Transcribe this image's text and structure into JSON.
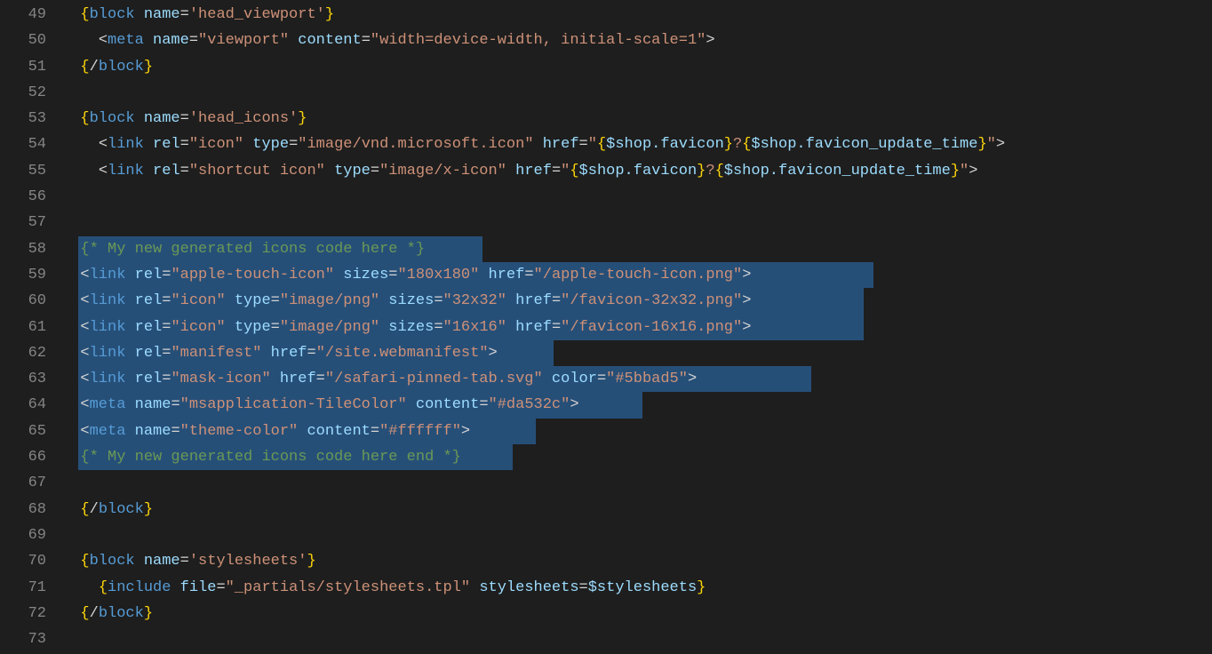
{
  "line_numbers": [
    "49",
    "50",
    "51",
    "52",
    "53",
    "54",
    "55",
    "56",
    "57",
    "58",
    "59",
    "60",
    "61",
    "62",
    "63",
    "64",
    "65",
    "66",
    "67",
    "68",
    "69",
    "70",
    "71",
    "72",
    "73"
  ],
  "lines": {
    "l49": {
      "indent": "  ",
      "t": [
        {
          "c": "t-brace",
          "s": "{"
        },
        {
          "c": "t-kw",
          "s": "block"
        },
        {
          "c": "t-delim",
          "s": " "
        },
        {
          "c": "t-attr",
          "s": "name"
        },
        {
          "c": "t-delim",
          "s": "="
        },
        {
          "c": "t-str",
          "s": "'head_viewport'"
        },
        {
          "c": "t-brace",
          "s": "}"
        }
      ]
    },
    "l50": {
      "indent": "    ",
      "t": [
        {
          "c": "t-delim",
          "s": "<"
        },
        {
          "c": "t-tag",
          "s": "meta"
        },
        {
          "c": "t-delim",
          "s": " "
        },
        {
          "c": "t-attr",
          "s": "name"
        },
        {
          "c": "t-delim",
          "s": "="
        },
        {
          "c": "t-str",
          "s": "\"viewport\""
        },
        {
          "c": "t-delim",
          "s": " "
        },
        {
          "c": "t-attr",
          "s": "content"
        },
        {
          "c": "t-delim",
          "s": "="
        },
        {
          "c": "t-str",
          "s": "\"width=device-width, initial-scale=1\""
        },
        {
          "c": "t-delim",
          "s": ">"
        }
      ]
    },
    "l51": {
      "indent": "  ",
      "t": [
        {
          "c": "t-brace",
          "s": "{"
        },
        {
          "c": "t-delim",
          "s": "/"
        },
        {
          "c": "t-kw",
          "s": "block"
        },
        {
          "c": "t-brace",
          "s": "}"
        }
      ]
    },
    "l52": {
      "indent": "",
      "t": []
    },
    "l53": {
      "indent": "  ",
      "t": [
        {
          "c": "t-brace",
          "s": "{"
        },
        {
          "c": "t-kw",
          "s": "block"
        },
        {
          "c": "t-delim",
          "s": " "
        },
        {
          "c": "t-attr",
          "s": "name"
        },
        {
          "c": "t-delim",
          "s": "="
        },
        {
          "c": "t-str",
          "s": "'head_icons'"
        },
        {
          "c": "t-brace",
          "s": "}"
        }
      ]
    },
    "l54": {
      "indent": "    ",
      "t": [
        {
          "c": "t-delim",
          "s": "<"
        },
        {
          "c": "t-tag",
          "s": "link"
        },
        {
          "c": "t-delim",
          "s": " "
        },
        {
          "c": "t-attr",
          "s": "rel"
        },
        {
          "c": "t-delim",
          "s": "="
        },
        {
          "c": "t-str",
          "s": "\"icon\""
        },
        {
          "c": "t-delim",
          "s": " "
        },
        {
          "c": "t-attr",
          "s": "type"
        },
        {
          "c": "t-delim",
          "s": "="
        },
        {
          "c": "t-str",
          "s": "\"image/vnd.microsoft.icon\""
        },
        {
          "c": "t-delim",
          "s": " "
        },
        {
          "c": "t-attr",
          "s": "href"
        },
        {
          "c": "t-delim",
          "s": "="
        },
        {
          "c": "t-str",
          "s": "\""
        },
        {
          "c": "t-brace",
          "s": "{"
        },
        {
          "c": "t-var",
          "s": "$shop.favicon"
        },
        {
          "c": "t-brace",
          "s": "}"
        },
        {
          "c": "t-str",
          "s": "?"
        },
        {
          "c": "t-brace",
          "s": "{"
        },
        {
          "c": "t-var",
          "s": "$shop.favicon_update_time"
        },
        {
          "c": "t-brace",
          "s": "}"
        },
        {
          "c": "t-str",
          "s": "\""
        },
        {
          "c": "t-delim",
          "s": ">"
        }
      ]
    },
    "l55": {
      "indent": "    ",
      "t": [
        {
          "c": "t-delim",
          "s": "<"
        },
        {
          "c": "t-tag",
          "s": "link"
        },
        {
          "c": "t-delim",
          "s": " "
        },
        {
          "c": "t-attr",
          "s": "rel"
        },
        {
          "c": "t-delim",
          "s": "="
        },
        {
          "c": "t-str",
          "s": "\"shortcut icon\""
        },
        {
          "c": "t-delim",
          "s": " "
        },
        {
          "c": "t-attr",
          "s": "type"
        },
        {
          "c": "t-delim",
          "s": "="
        },
        {
          "c": "t-str",
          "s": "\"image/x-icon\""
        },
        {
          "c": "t-delim",
          "s": " "
        },
        {
          "c": "t-attr",
          "s": "href"
        },
        {
          "c": "t-delim",
          "s": "="
        },
        {
          "c": "t-str",
          "s": "\""
        },
        {
          "c": "t-brace",
          "s": "{"
        },
        {
          "c": "t-var",
          "s": "$shop.favicon"
        },
        {
          "c": "t-brace",
          "s": "}"
        },
        {
          "c": "t-str",
          "s": "?"
        },
        {
          "c": "t-brace",
          "s": "{"
        },
        {
          "c": "t-var",
          "s": "$shop.favicon_update_time"
        },
        {
          "c": "t-brace",
          "s": "}"
        },
        {
          "c": "t-str",
          "s": "\""
        },
        {
          "c": "t-delim",
          "s": ">"
        }
      ]
    },
    "l56": {
      "indent": "",
      "t": []
    },
    "l57": {
      "indent": "",
      "t": []
    },
    "l58": {
      "indent": "  ",
      "sel_w": 455,
      "t": [
        {
          "c": "t-comment",
          "s": "{* My new generated icons code here *}"
        }
      ]
    },
    "l59": {
      "indent": "  ",
      "sel_w": 895,
      "t": [
        {
          "c": "t-delim",
          "s": "<"
        },
        {
          "c": "t-tag",
          "s": "link"
        },
        {
          "c": "t-delim",
          "s": " "
        },
        {
          "c": "t-attr",
          "s": "rel"
        },
        {
          "c": "t-delim",
          "s": "="
        },
        {
          "c": "t-str",
          "s": "\"apple-touch-icon\""
        },
        {
          "c": "t-delim",
          "s": " "
        },
        {
          "c": "t-attr",
          "s": "sizes"
        },
        {
          "c": "t-delim",
          "s": "="
        },
        {
          "c": "t-str",
          "s": "\"180x180\""
        },
        {
          "c": "t-delim",
          "s": " "
        },
        {
          "c": "t-attr",
          "s": "href"
        },
        {
          "c": "t-delim",
          "s": "="
        },
        {
          "c": "t-str",
          "s": "\"/apple-touch-icon.png\""
        },
        {
          "c": "t-delim",
          "s": ">"
        }
      ]
    },
    "l60": {
      "indent": "  ",
      "sel_w": 884,
      "t": [
        {
          "c": "t-delim",
          "s": "<"
        },
        {
          "c": "t-tag",
          "s": "link"
        },
        {
          "c": "t-delim",
          "s": " "
        },
        {
          "c": "t-attr",
          "s": "rel"
        },
        {
          "c": "t-delim",
          "s": "="
        },
        {
          "c": "t-str",
          "s": "\"icon\""
        },
        {
          "c": "t-delim",
          "s": " "
        },
        {
          "c": "t-attr",
          "s": "type"
        },
        {
          "c": "t-delim",
          "s": "="
        },
        {
          "c": "t-str",
          "s": "\"image/png\""
        },
        {
          "c": "t-delim",
          "s": " "
        },
        {
          "c": "t-attr",
          "s": "sizes"
        },
        {
          "c": "t-delim",
          "s": "="
        },
        {
          "c": "t-str",
          "s": "\"32x32\""
        },
        {
          "c": "t-delim",
          "s": " "
        },
        {
          "c": "t-attr",
          "s": "href"
        },
        {
          "c": "t-delim",
          "s": "="
        },
        {
          "c": "t-str",
          "s": "\"/favicon-32x32.png\""
        },
        {
          "c": "t-delim",
          "s": ">"
        }
      ]
    },
    "l61": {
      "indent": "  ",
      "sel_w": 884,
      "t": [
        {
          "c": "t-delim",
          "s": "<"
        },
        {
          "c": "t-tag",
          "s": "link"
        },
        {
          "c": "t-delim",
          "s": " "
        },
        {
          "c": "t-attr",
          "s": "rel"
        },
        {
          "c": "t-delim",
          "s": "="
        },
        {
          "c": "t-str",
          "s": "\"icon\""
        },
        {
          "c": "t-delim",
          "s": " "
        },
        {
          "c": "t-attr",
          "s": "type"
        },
        {
          "c": "t-delim",
          "s": "="
        },
        {
          "c": "t-str",
          "s": "\"image/png\""
        },
        {
          "c": "t-delim",
          "s": " "
        },
        {
          "c": "t-attr",
          "s": "sizes"
        },
        {
          "c": "t-delim",
          "s": "="
        },
        {
          "c": "t-str",
          "s": "\"16x16\""
        },
        {
          "c": "t-delim",
          "s": " "
        },
        {
          "c": "t-attr",
          "s": "href"
        },
        {
          "c": "t-delim",
          "s": "="
        },
        {
          "c": "t-str",
          "s": "\"/favicon-16x16.png\""
        },
        {
          "c": "t-delim",
          "s": ">"
        }
      ]
    },
    "l62": {
      "indent": "  ",
      "sel_w": 535,
      "t": [
        {
          "c": "t-delim",
          "s": "<"
        },
        {
          "c": "t-tag",
          "s": "link"
        },
        {
          "c": "t-delim",
          "s": " "
        },
        {
          "c": "t-attr",
          "s": "rel"
        },
        {
          "c": "t-delim",
          "s": "="
        },
        {
          "c": "t-str",
          "s": "\"manifest\""
        },
        {
          "c": "t-delim",
          "s": " "
        },
        {
          "c": "t-attr",
          "s": "href"
        },
        {
          "c": "t-delim",
          "s": "="
        },
        {
          "c": "t-str",
          "s": "\"/site.webmanifest\""
        },
        {
          "c": "t-delim",
          "s": ">"
        }
      ]
    },
    "l63": {
      "indent": "  ",
      "sel_w": 825,
      "t": [
        {
          "c": "t-delim",
          "s": "<"
        },
        {
          "c": "t-tag",
          "s": "link"
        },
        {
          "c": "t-delim",
          "s": " "
        },
        {
          "c": "t-attr",
          "s": "rel"
        },
        {
          "c": "t-delim",
          "s": "="
        },
        {
          "c": "t-str",
          "s": "\"mask-icon\""
        },
        {
          "c": "t-delim",
          "s": " "
        },
        {
          "c": "t-attr",
          "s": "href"
        },
        {
          "c": "t-delim",
          "s": "="
        },
        {
          "c": "t-str",
          "s": "\"/safari-pinned-tab.svg\""
        },
        {
          "c": "t-delim",
          "s": " "
        },
        {
          "c": "t-attr",
          "s": "color"
        },
        {
          "c": "t-delim",
          "s": "="
        },
        {
          "c": "t-str",
          "s": "\"#5bbad5\""
        },
        {
          "c": "t-delim",
          "s": ">"
        }
      ]
    },
    "l64": {
      "indent": "  ",
      "sel_w": 635,
      "t": [
        {
          "c": "t-delim",
          "s": "<"
        },
        {
          "c": "t-tag",
          "s": "meta"
        },
        {
          "c": "t-delim",
          "s": " "
        },
        {
          "c": "t-attr",
          "s": "name"
        },
        {
          "c": "t-delim",
          "s": "="
        },
        {
          "c": "t-str",
          "s": "\"msapplication-TileColor\""
        },
        {
          "c": "t-delim",
          "s": " "
        },
        {
          "c": "t-attr",
          "s": "content"
        },
        {
          "c": "t-delim",
          "s": "="
        },
        {
          "c": "t-str",
          "s": "\"#da532c\""
        },
        {
          "c": "t-delim",
          "s": ">"
        }
      ]
    },
    "l65": {
      "indent": "  ",
      "sel_w": 515,
      "t": [
        {
          "c": "t-delim",
          "s": "<"
        },
        {
          "c": "t-tag",
          "s": "meta"
        },
        {
          "c": "t-delim",
          "s": " "
        },
        {
          "c": "t-attr",
          "s": "name"
        },
        {
          "c": "t-delim",
          "s": "="
        },
        {
          "c": "t-str",
          "s": "\"theme-color\""
        },
        {
          "c": "t-delim",
          "s": " "
        },
        {
          "c": "t-attr",
          "s": "content"
        },
        {
          "c": "t-delim",
          "s": "="
        },
        {
          "c": "t-str",
          "s": "\"#ffffff\""
        },
        {
          "c": "t-delim",
          "s": ">"
        }
      ]
    },
    "l66": {
      "indent": "  ",
      "sel_w": 489,
      "t": [
        {
          "c": "t-comment",
          "s": "{* My new generated icons code here end *}"
        }
      ]
    },
    "l67": {
      "indent": "",
      "t": []
    },
    "l68": {
      "indent": "  ",
      "t": [
        {
          "c": "t-brace",
          "s": "{"
        },
        {
          "c": "t-delim",
          "s": "/"
        },
        {
          "c": "t-kw",
          "s": "block"
        },
        {
          "c": "t-brace",
          "s": "}"
        }
      ]
    },
    "l69": {
      "indent": "",
      "t": []
    },
    "l70": {
      "indent": "  ",
      "t": [
        {
          "c": "t-brace",
          "s": "{"
        },
        {
          "c": "t-kw",
          "s": "block"
        },
        {
          "c": "t-delim",
          "s": " "
        },
        {
          "c": "t-attr",
          "s": "name"
        },
        {
          "c": "t-delim",
          "s": "="
        },
        {
          "c": "t-str",
          "s": "'stylesheets'"
        },
        {
          "c": "t-brace",
          "s": "}"
        }
      ]
    },
    "l71": {
      "indent": "    ",
      "t": [
        {
          "c": "t-brace",
          "s": "{"
        },
        {
          "c": "t-kw",
          "s": "include"
        },
        {
          "c": "t-delim",
          "s": " "
        },
        {
          "c": "t-attr",
          "s": "file"
        },
        {
          "c": "t-delim",
          "s": "="
        },
        {
          "c": "t-str",
          "s": "\"_partials/stylesheets.tpl\""
        },
        {
          "c": "t-delim",
          "s": " "
        },
        {
          "c": "t-attr",
          "s": "stylesheets"
        },
        {
          "c": "t-delim",
          "s": "="
        },
        {
          "c": "t-var",
          "s": "$stylesheets"
        },
        {
          "c": "t-brace",
          "s": "}"
        }
      ]
    },
    "l72": {
      "indent": "  ",
      "t": [
        {
          "c": "t-brace",
          "s": "{"
        },
        {
          "c": "t-delim",
          "s": "/"
        },
        {
          "c": "t-kw",
          "s": "block"
        },
        {
          "c": "t-brace",
          "s": "}"
        }
      ]
    },
    "l73": {
      "indent": "",
      "t": []
    }
  }
}
